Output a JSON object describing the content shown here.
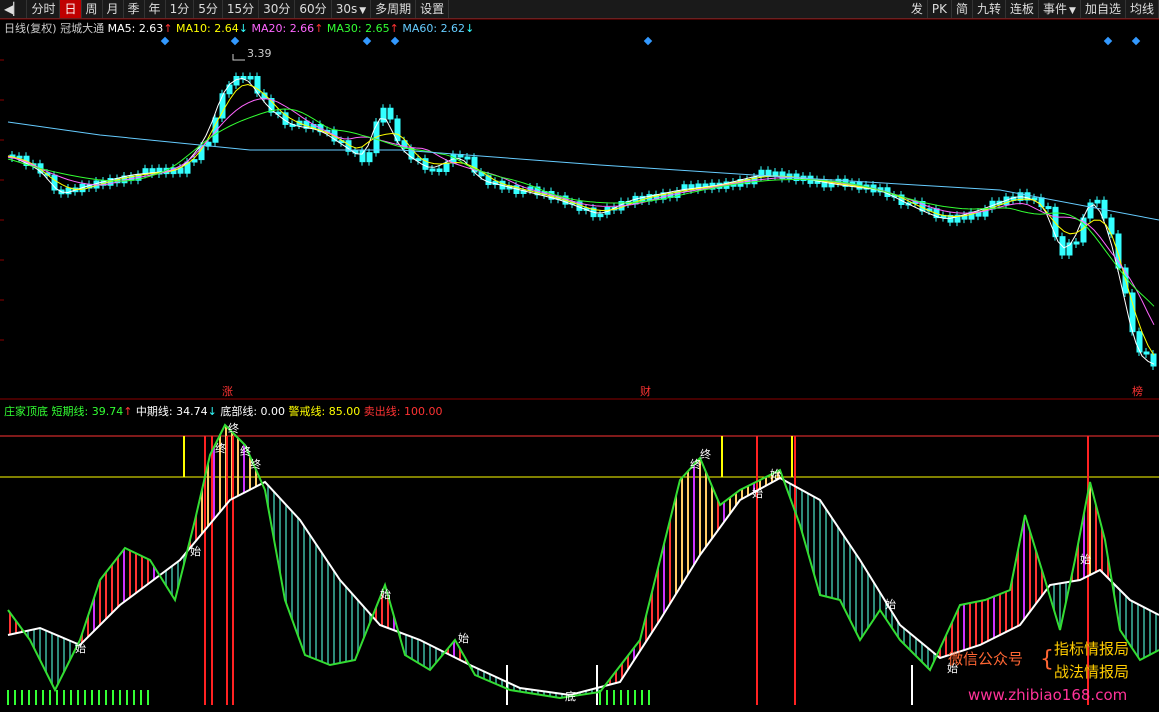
{
  "toolbar": {
    "items": [
      "分时",
      "日",
      "周",
      "月",
      "季",
      "年",
      "1分",
      "5分",
      "15分",
      "30分",
      "60分",
      "30s",
      "多周期",
      "设置"
    ],
    "active": "日",
    "right_items": [
      "发",
      "PK",
      "简",
      "九转",
      "连板",
      "事件",
      "加自选",
      "均线"
    ]
  },
  "main_panel": {
    "label": "日线(复权)",
    "stock": "冠城大通",
    "ma": [
      {
        "name": "MA5",
        "value": "2.63",
        "arrow": "↑",
        "color": "#ffffff"
      },
      {
        "name": "MA10",
        "value": "2.64",
        "arrow": "↓",
        "color": "#ffff00"
      },
      {
        "name": "MA20",
        "value": "2.66",
        "arrow": "↑",
        "color": "#ff66ff"
      },
      {
        "name": "MA30",
        "value": "2.65",
        "arrow": "↑",
        "color": "#33ff33"
      },
      {
        "name": "MA60",
        "value": "2.62",
        "arrow": "↓",
        "color": "#66ccff"
      }
    ],
    "high_label": "3.39",
    "markers": [
      "涨",
      "财",
      "榜"
    ]
  },
  "sub_panel": {
    "title": "庄家顶底",
    "lines": [
      {
        "name": "短期线",
        "value": "39.74",
        "arrow": "↑",
        "color": "#33ff33"
      },
      {
        "name": "中期线",
        "value": "34.74",
        "arrow": "↓",
        "color": "#ffffff"
      },
      {
        "name": "底部线",
        "value": "0.00",
        "arrow": "",
        "color": "#ffffff"
      },
      {
        "name": "警戒线",
        "value": "85.00",
        "arrow": "",
        "color": "#ffff00"
      },
      {
        "name": "卖出线",
        "value": "100.00",
        "arrow": "",
        "color": "#ff3333"
      }
    ],
    "signals": {
      "start": "始",
      "end": "终",
      "bottom": "底"
    }
  },
  "watermark": {
    "wechat": "微信公众号",
    "line1": "指标情报局",
    "line2": "战法情报局",
    "url": "www.zhibiao168.com"
  },
  "colors": {
    "up": "#ff3333",
    "down": "#33ffff",
    "grid": "#8b0000"
  }
}
